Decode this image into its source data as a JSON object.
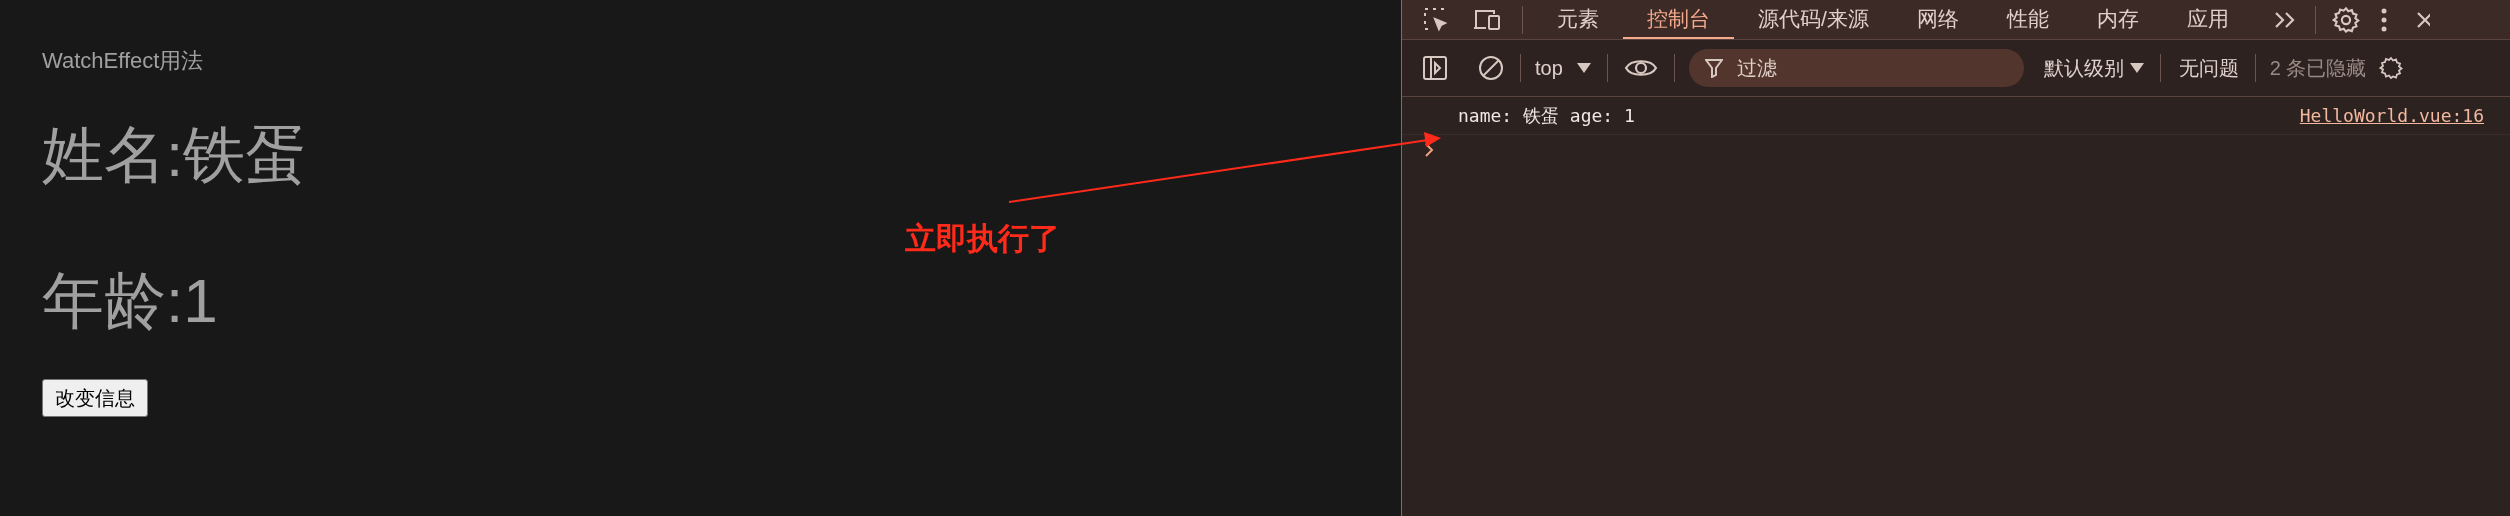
{
  "page": {
    "heading": "WatchEffect用法",
    "name_line": "姓名:铁蛋",
    "age_line": "年龄:1",
    "button": "改变信息"
  },
  "annotation": {
    "text": "立即执行了"
  },
  "devtools": {
    "tabs": [
      {
        "label": "元素",
        "selected": false
      },
      {
        "label": "控制台",
        "selected": true
      },
      {
        "label": "源代码/来源",
        "selected": false
      },
      {
        "label": "网络",
        "selected": false
      },
      {
        "label": "性能",
        "selected": false
      },
      {
        "label": "内存",
        "selected": false
      },
      {
        "label": "应用",
        "selected": false
      }
    ],
    "context": "top",
    "filter_placeholder": "过滤",
    "level": "默认级别",
    "issues": "无问题",
    "hidden": "2 条已隐藏",
    "messages": [
      {
        "text": "name: 铁蛋 age: 1",
        "source": "HelloWorld.vue:16"
      }
    ]
  }
}
